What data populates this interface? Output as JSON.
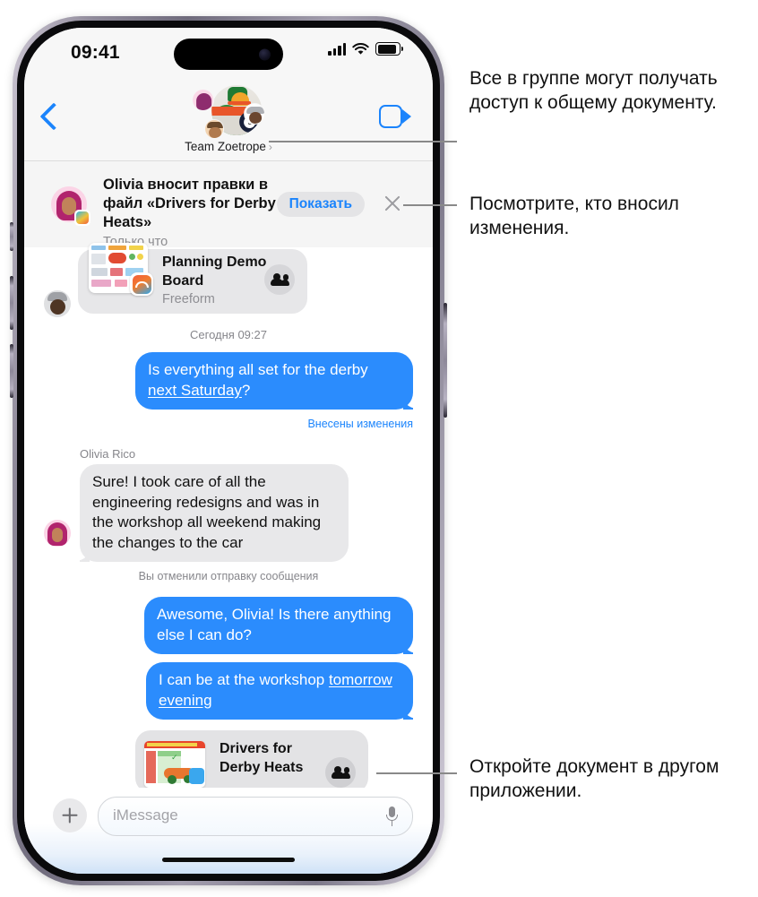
{
  "status_bar": {
    "time": "09:41",
    "cellular_icon": "cellular-signal-icon",
    "wifi_icon": "wifi-icon",
    "battery_icon": "battery-icon"
  },
  "nav_bar": {
    "back_icon": "back-chevron-icon",
    "facetime_icon": "video-camera-icon",
    "group_name": "Team Zoetrope",
    "group_chevron": "›"
  },
  "banner": {
    "title": "Olivia вносит правки в файл «Drivers for Derby Heats»",
    "subtitle": "Только что",
    "action_label": "Показать",
    "close_icon": "close-x-icon",
    "avatar_name": "olivia-avatar",
    "app_badge_icon": "numbers-app-badge-icon"
  },
  "conversation": {
    "freeform_card": {
      "title": "Planning Demo Board",
      "app": "Freeform",
      "people_icon": "shared-with-you-people-icon",
      "sender_avatar": "grant-avatar"
    },
    "timestamp": "Сегодня 09:27",
    "messages": [
      {
        "id": "msg-1",
        "direction": "outgoing",
        "text_before": "Is everything all set for the derby ",
        "text_link": "next Saturday",
        "text_after": "?",
        "meta": "Внесены изменения",
        "meta_align": "right"
      },
      {
        "id": "msg-2",
        "direction": "incoming",
        "sender": "Olivia Rico",
        "text": "Sure! I took care of all the engineering redesigns and was in the workshop all weekend making the changes to the car",
        "meta": "Вы отменили отправку сообщения",
        "meta_align": "center",
        "avatar_name": "olivia-avatar"
      },
      {
        "id": "msg-3",
        "direction": "outgoing",
        "text_before": "Awesome, Olivia! Is there anything else I can do?",
        "text_link": "",
        "text_after": ""
      },
      {
        "id": "msg-4",
        "direction": "outgoing",
        "text_before": "I can be at the workshop ",
        "text_link": "tomorrow evening",
        "text_after": ""
      }
    ],
    "document_card": {
      "title": "Drivers for Derby Heats",
      "people_icon": "shared-with-you-people-icon"
    }
  },
  "composer": {
    "plus_icon": "plus-icon",
    "placeholder": "iMessage",
    "mic_icon": "microphone-icon"
  },
  "callouts": [
    {
      "id": "callout-1",
      "text": "Все в группе могут получать доступ к общему документу."
    },
    {
      "id": "callout-2",
      "text": "Посмотрите, кто вносил изменения."
    },
    {
      "id": "callout-3",
      "text": "Откройте документ в другом приложении."
    }
  ],
  "colors": {
    "accent_blue": "#1b84fc",
    "bubble_blue": "#2b8cfd",
    "bubble_gray": "#e8e8ea",
    "banner_bg": "#f5f5f5"
  }
}
